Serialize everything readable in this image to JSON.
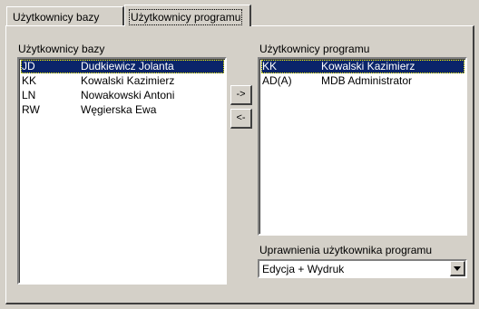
{
  "tabs": [
    {
      "label": "Użytkownicy bazy"
    },
    {
      "label": "Użytkownicy programu"
    }
  ],
  "db_users": {
    "label": "Użytkownicy bazy",
    "rows": [
      {
        "code": "JD",
        "name": "Dudkiewicz Jolanta",
        "selected": true
      },
      {
        "code": "KK",
        "name": "Kowalski Kazimierz",
        "selected": false
      },
      {
        "code": "LN",
        "name": "Nowakowski Antoni",
        "selected": false
      },
      {
        "code": "RW",
        "name": "Węgierska Ewa",
        "selected": false
      }
    ]
  },
  "buttons": {
    "add_label": "->",
    "remove_label": "<-"
  },
  "program_users": {
    "label": "Użytkownicy programu",
    "rows": [
      {
        "code": "KK",
        "name": "Kowalski Kazimierz",
        "selected": true
      },
      {
        "code": "AD(A)",
        "name": "MDB Administrator",
        "selected": false
      }
    ]
  },
  "permissions": {
    "label": "Uprawnienia użytkownika programu",
    "selected": "Edycja + Wydruk"
  },
  "colors": {
    "window_bg": "#d4d0c8",
    "selection_bg": "#0a246a",
    "selection_fg": "#ffffff"
  }
}
